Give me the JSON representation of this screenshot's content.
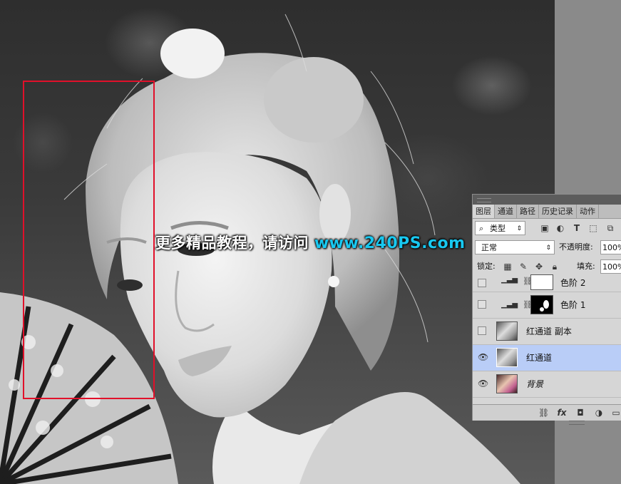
{
  "watermark": {
    "text_cn": "更多精品教程，请访问",
    "text_url": "www.240PS.com"
  },
  "colors": {
    "selection_rect": "#e1102a",
    "watermark_url": "#18c8f0",
    "layer_selected": "#b9cdf7"
  },
  "layers_panel": {
    "tabs": [
      {
        "label": "图层",
        "active": true
      },
      {
        "label": "通道",
        "active": false
      },
      {
        "label": "路径",
        "active": false
      },
      {
        "label": "历史记录",
        "active": false
      },
      {
        "label": "动作",
        "active": false
      }
    ],
    "filter": {
      "label": "类型",
      "icons": [
        "image-filter-icon",
        "adjustment-filter-icon",
        "type-filter-icon",
        "shape-filter-icon",
        "smart-object-filter-icon"
      ]
    },
    "blend_mode": "正常",
    "opacity": {
      "label": "不透明度:",
      "value": "100%"
    },
    "lock": {
      "label": "锁定:",
      "icons": [
        "lock-transparent-icon",
        "lock-image-icon",
        "lock-position-icon",
        "lock-all-icon"
      ]
    },
    "fill": {
      "label": "填充:",
      "value": "100%"
    },
    "layers": [
      {
        "name": "色阶 2",
        "visible": false,
        "selected": false,
        "kind": "adjustment",
        "mask": "white"
      },
      {
        "name": "色阶 1",
        "visible": false,
        "selected": false,
        "kind": "adjustment",
        "mask": "black"
      },
      {
        "name": "红通道 副本",
        "visible": false,
        "selected": false,
        "kind": "pixel",
        "thumb": "gray"
      },
      {
        "name": "红通道",
        "visible": true,
        "selected": true,
        "kind": "pixel",
        "thumb": "gray"
      },
      {
        "name": "背景",
        "visible": true,
        "selected": false,
        "kind": "pixel",
        "thumb": "color",
        "italic": true
      }
    ],
    "bottom_icons": [
      "link-layers-icon",
      "fx-icon",
      "add-mask-icon",
      "new-adjustment-icon",
      "new-group-icon"
    ]
  }
}
